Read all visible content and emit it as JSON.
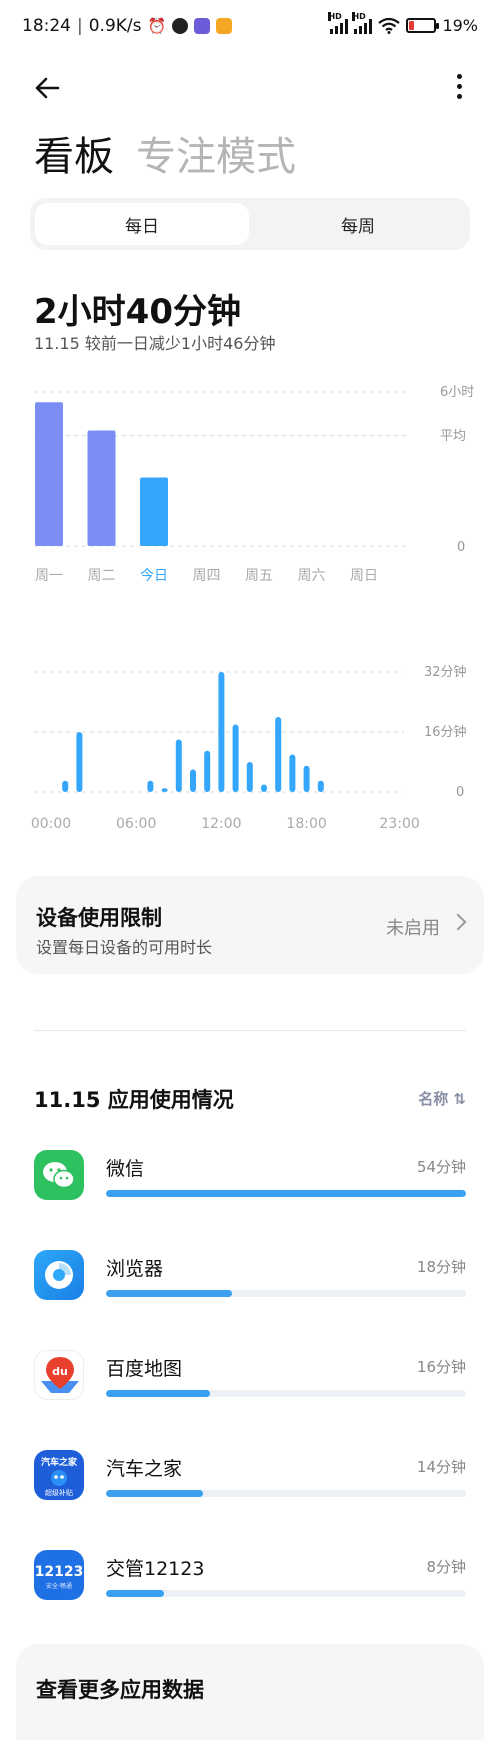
{
  "status_bar": {
    "time": "18:24",
    "speed": "0.9K/s",
    "battery": "19%"
  },
  "header": {
    "title_active": "看板",
    "title_inactive": "专注模式"
  },
  "tabs": [
    {
      "label": "每日"
    },
    {
      "label": "每周"
    }
  ],
  "summary": {
    "total": "2小时40分钟",
    "date": "11.15",
    "compare": "较前一日减少1小时46分钟"
  },
  "weekly_chart_labels": {
    "y_max": "6小时",
    "avg": "平均",
    "y_zero": "0"
  },
  "hourly_chart_labels": {
    "y_top": "32分钟",
    "y_mid": "16分钟",
    "y_zero": "0"
  },
  "chart_data": [
    {
      "type": "bar",
      "categories": [
        "周一",
        "周二",
        "今日",
        "周四",
        "周五",
        "周六",
        "周日"
      ],
      "values": [
        5.6,
        4.5,
        2.67,
        null,
        null,
        null,
        null
      ],
      "ylim": [
        0,
        6
      ],
      "average": 4.3,
      "colors": [
        "#7b8ef6",
        "#7b8ef6",
        "#34a6fb"
      ],
      "grid": true
    },
    {
      "type": "bar",
      "x_ticks": [
        "00:00",
        "06:00",
        "12:00",
        "18:00",
        "23:00"
      ],
      "x": [
        1,
        2,
        7,
        8,
        9,
        10,
        11,
        12,
        13,
        14,
        15,
        16,
        17,
        18,
        19
      ],
      "values": [
        3,
        16,
        3,
        1,
        14,
        6,
        11,
        32,
        18,
        8,
        2,
        20,
        10,
        7,
        3
      ],
      "ylim": [
        0,
        32
      ],
      "color": "#34a6fb",
      "grid": true
    }
  ],
  "limit_card": {
    "title": "设备使用限制",
    "subtitle": "设置每日设备的可用时长",
    "status": "未启用"
  },
  "usage": {
    "title": "11.15 应用使用情况",
    "sort_label": "名称 ⇅",
    "apps": [
      {
        "name": "微信",
        "time": "54分钟",
        "fraction": 1.0,
        "icon": "wechat-icon"
      },
      {
        "name": "浏览器",
        "time": "18分钟",
        "fraction": 0.35,
        "icon": "browser-icon"
      },
      {
        "name": "百度地图",
        "time": "16分钟",
        "fraction": 0.29,
        "icon": "baidu-map-icon"
      },
      {
        "name": "汽车之家",
        "time": "14分钟",
        "fraction": 0.27,
        "icon": "autohome-icon"
      },
      {
        "name": "交管12123",
        "time": "8分钟",
        "fraction": 0.16,
        "icon": "traffic-12123-icon"
      }
    ]
  },
  "autohome_icon": {
    "top": "汽车之家",
    "bottom": "超级补贴"
  },
  "traffic_icon": {
    "top": "12123",
    "bottom": "安全·畅通"
  },
  "baidu_icon": {
    "label": "du"
  },
  "bottom_card": {
    "title": "查看更多应用数据"
  }
}
